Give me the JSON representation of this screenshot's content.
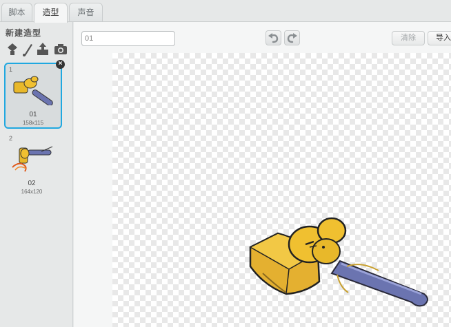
{
  "tabs": [
    {
      "label": "脚本",
      "active": false
    },
    {
      "label": "造型",
      "active": true
    },
    {
      "label": "声音",
      "active": false
    }
  ],
  "sidebar": {
    "title": "新建造型",
    "tools": [
      "paint-from-library-icon",
      "paint-brush-icon",
      "upload-icon",
      "camera-icon"
    ],
    "costumes": [
      {
        "index": "1",
        "name": "01",
        "size": "158x115",
        "selected": true
      },
      {
        "index": "2",
        "name": "02",
        "size": "164x120",
        "selected": false
      }
    ]
  },
  "editor": {
    "costume_name": "01",
    "clear_label": "清除",
    "import_label": "导入"
  },
  "colors": {
    "selection": "#20a8e0",
    "hammer_head": "#f0c030",
    "hammer_handle": "#6b74b0"
  }
}
